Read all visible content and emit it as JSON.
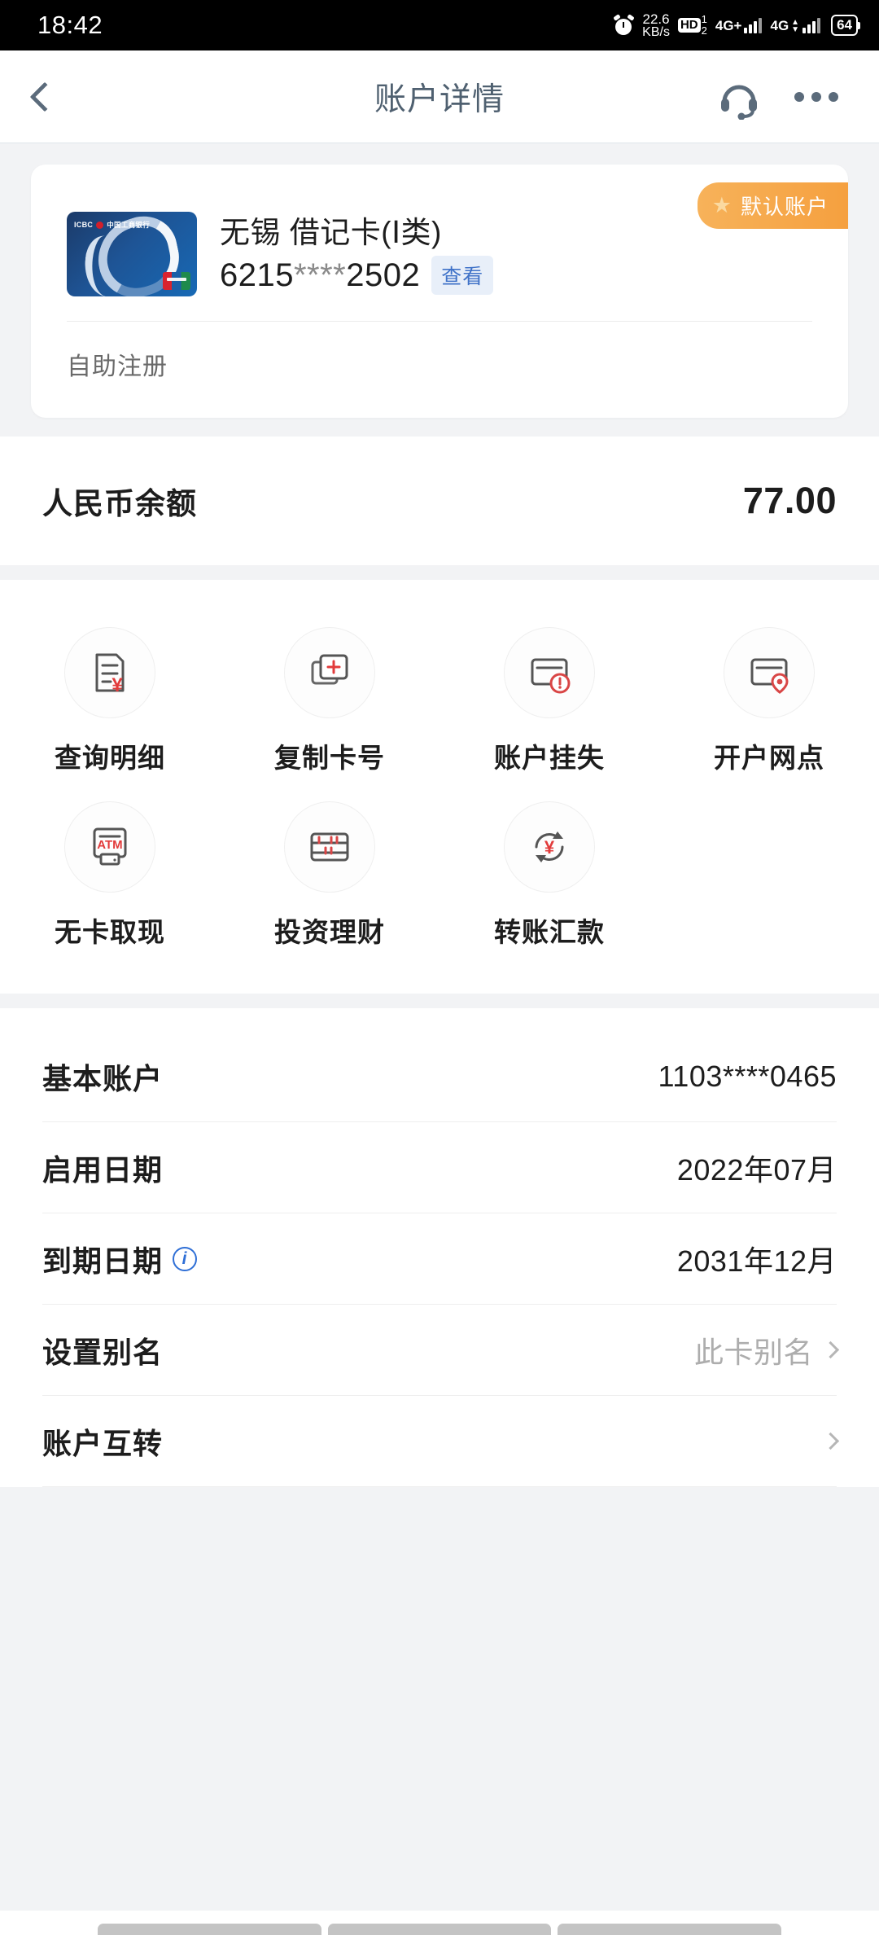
{
  "statusbar": {
    "time": "18:42",
    "alarm_icon": "alarm-icon",
    "net_speed_value": "22.6",
    "net_speed_unit": "KB/s",
    "hd_label": "HD",
    "hd_slot_top": "1",
    "hd_slot_bottom": "2",
    "sim1_network": "4G+",
    "sim2_network": "4G",
    "battery": "64"
  },
  "header": {
    "back_icon": "chevron-left-icon",
    "title": "账户详情",
    "support_icon": "headset-icon",
    "more_icon": "more-dots-icon"
  },
  "card": {
    "badge_label": "默认账户",
    "badge_star": "★",
    "badge_color": "#f5a03f",
    "bank_logo_en": "ICBC",
    "bank_logo_cn": "中国工商银行",
    "account_name": "无锡 借记卡(Ⅰ类)",
    "card_number_prefix": "6215",
    "card_number_mask": "****",
    "card_number_suffix": "2502",
    "view_label": "查看",
    "view_color": "#3f72c8",
    "sub_label": "自助注册"
  },
  "balance": {
    "label": "人民币余额",
    "value": "77.00"
  },
  "actions": [
    {
      "label": "查询明细",
      "icon": "statement-yuan-icon"
    },
    {
      "label": "复制卡号",
      "icon": "copy-card-icon"
    },
    {
      "label": "账户挂失",
      "icon": "card-alert-icon"
    },
    {
      "label": "开户网点",
      "icon": "card-location-icon"
    },
    {
      "label": "无卡取现",
      "icon": "atm-icon"
    },
    {
      "label": "投资理财",
      "icon": "abacus-icon"
    },
    {
      "label": "转账汇款",
      "icon": "transfer-yuan-icon"
    }
  ],
  "details": [
    {
      "key": "基本账户",
      "value": "1103****0465",
      "info": false,
      "chevron": false,
      "muted": false
    },
    {
      "key": "启用日期",
      "value": "2022年07月",
      "info": false,
      "chevron": false,
      "muted": false
    },
    {
      "key": "到期日期",
      "value": "2031年12月",
      "info": true,
      "info_icon": "info-circle-icon",
      "chevron": false,
      "muted": false
    },
    {
      "key": "设置别名",
      "value": "此卡别名",
      "info": false,
      "chevron": true,
      "chevron_icon": "chevron-right-icon",
      "muted": true
    },
    {
      "key": "账户互转",
      "value": "",
      "info": false,
      "chevron": true,
      "chevron_icon": "chevron-right-icon",
      "muted": false
    }
  ]
}
